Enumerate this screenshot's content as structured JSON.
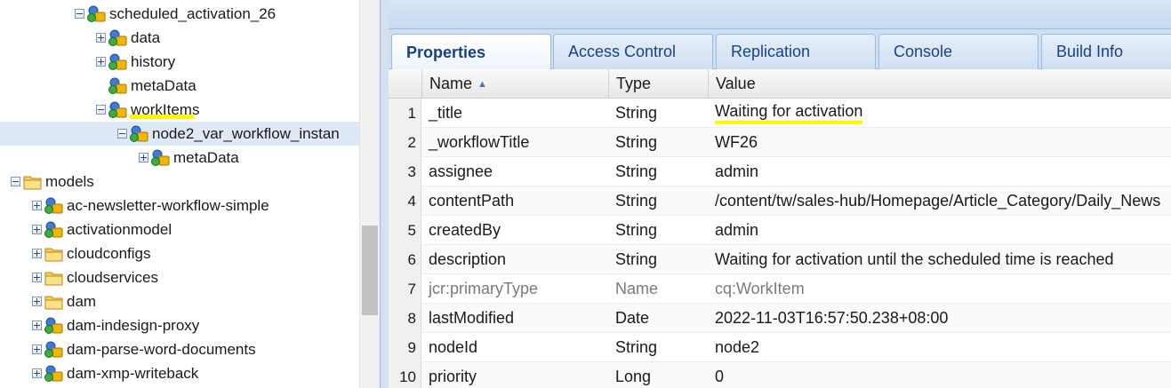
{
  "tree": {
    "nodes": [
      {
        "label": "scheduled_activation_26",
        "icon": "node-icon",
        "toggle": "minus",
        "highlight": false,
        "selected": false
      },
      {
        "label": "data",
        "icon": "node-icon",
        "toggle": "plus",
        "highlight": false,
        "selected": false
      },
      {
        "label": "history",
        "icon": "node-icon",
        "toggle": "plus",
        "highlight": false,
        "selected": false
      },
      {
        "label": "metaData",
        "icon": "node-icon",
        "toggle": "none",
        "highlight": false,
        "selected": false
      },
      {
        "label": "workItems",
        "icon": "node-icon",
        "toggle": "minus",
        "highlight": true,
        "selected": false
      },
      {
        "label": "node2_var_workflow_instan",
        "icon": "node-icon",
        "toggle": "minus",
        "highlight": false,
        "selected": true
      },
      {
        "label": "metaData",
        "icon": "node-icon",
        "toggle": "plus",
        "highlight": false,
        "selected": false
      },
      {
        "label": "models",
        "icon": "folder-icon",
        "toggle": "minus",
        "highlight": false,
        "selected": false
      },
      {
        "label": "ac-newsletter-workflow-simple",
        "icon": "node-icon",
        "toggle": "plus",
        "highlight": false,
        "selected": false
      },
      {
        "label": "activationmodel",
        "icon": "node-icon",
        "toggle": "plus",
        "highlight": false,
        "selected": false
      },
      {
        "label": "cloudconfigs",
        "icon": "folder-icon",
        "toggle": "plus",
        "highlight": false,
        "selected": false
      },
      {
        "label": "cloudservices",
        "icon": "folder-icon",
        "toggle": "plus",
        "highlight": false,
        "selected": false
      },
      {
        "label": "dam",
        "icon": "folder-icon",
        "toggle": "plus",
        "highlight": false,
        "selected": false
      },
      {
        "label": "dam-indesign-proxy",
        "icon": "node-icon",
        "toggle": "plus",
        "highlight": false,
        "selected": false
      },
      {
        "label": "dam-parse-word-documents",
        "icon": "node-icon",
        "toggle": "plus",
        "highlight": false,
        "selected": false
      },
      {
        "label": "dam-xmp-writeback",
        "icon": "node-icon",
        "toggle": "plus",
        "highlight": false,
        "selected": false
      }
    ]
  },
  "tabs": [
    {
      "label": "Properties",
      "active": true
    },
    {
      "label": "Access Control",
      "active": false
    },
    {
      "label": "Replication",
      "active": false
    },
    {
      "label": "Console",
      "active": false
    },
    {
      "label": "Build Info",
      "active": false
    }
  ],
  "grid": {
    "headers": {
      "name": "Name",
      "type": "Type",
      "value": "Value"
    },
    "rows": [
      {
        "num": "1",
        "name": "_title",
        "type": "String",
        "value": "Waiting for activation",
        "dim": false,
        "highlight": true
      },
      {
        "num": "2",
        "name": "_workflowTitle",
        "type": "String",
        "value": "WF26",
        "dim": false,
        "highlight": false
      },
      {
        "num": "3",
        "name": "assignee",
        "type": "String",
        "value": "admin",
        "dim": false,
        "highlight": false
      },
      {
        "num": "4",
        "name": "contentPath",
        "type": "String",
        "value": "/content/tw/sales-hub/Homepage/Article_Category/Daily_News",
        "dim": false,
        "highlight": false
      },
      {
        "num": "5",
        "name": "createdBy",
        "type": "String",
        "value": "admin",
        "dim": false,
        "highlight": false
      },
      {
        "num": "6",
        "name": "description",
        "type": "String",
        "value": "Waiting for activation until the scheduled time is reached",
        "dim": false,
        "highlight": false
      },
      {
        "num": "7",
        "name": "jcr:primaryType",
        "type": "Name",
        "value": "cq:WorkItem",
        "dim": true,
        "highlight": false
      },
      {
        "num": "8",
        "name": "lastModified",
        "type": "Date",
        "value": "2022-11-03T16:57:50.238+08:00",
        "dim": false,
        "highlight": false
      },
      {
        "num": "9",
        "name": "nodeId",
        "type": "String",
        "value": "node2",
        "dim": false,
        "highlight": false
      },
      {
        "num": "10",
        "name": "priority",
        "type": "Long",
        "value": "0",
        "dim": false,
        "highlight": false
      }
    ]
  },
  "colors": {
    "highlight": "#fff600",
    "selected_row": "#dfe8f6",
    "tab_text": "#15428b"
  }
}
